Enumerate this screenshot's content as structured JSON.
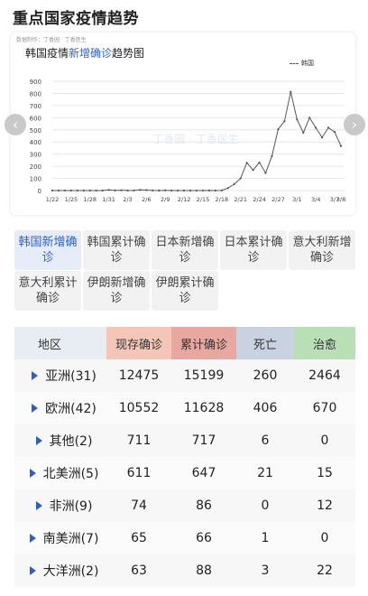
{
  "page": {
    "heading": "重点国家疫情趋势"
  },
  "chart_card": {
    "source": "数据制作：丁香园 · 丁香医生",
    "title_prefix": "韩国疫情",
    "title_highlight": "新增确诊",
    "title_suffix": "趋势图",
    "watermark": "丁香园 · 丁香医生",
    "prev_icon": "chevron-left-icon",
    "next_icon": "chevron-right-icon"
  },
  "chart_data": {
    "type": "line",
    "title": "韩国疫情新增确诊趋势图",
    "series": [
      {
        "name": "韩国",
        "color": "#555555",
        "x": [
          "1/22",
          "1/23",
          "1/24",
          "1/25",
          "1/26",
          "1/27",
          "1/28",
          "1/29",
          "1/30",
          "1/31",
          "2/1",
          "2/2",
          "2/3",
          "2/4",
          "2/5",
          "2/6",
          "2/7",
          "2/8",
          "2/9",
          "2/10",
          "2/11",
          "2/12",
          "2/13",
          "2/14",
          "2/15",
          "2/16",
          "2/17",
          "2/18",
          "2/19",
          "2/20",
          "2/21",
          "2/22",
          "2/23",
          "2/24",
          "2/25",
          "2/26",
          "2/27",
          "2/28",
          "2/29",
          "3/1",
          "3/2",
          "3/3",
          "3/4",
          "3/5",
          "3/6",
          "3/7",
          "3/8"
        ],
        "values": [
          0,
          0,
          0,
          0,
          0,
          0,
          0,
          0,
          0,
          5,
          1,
          3,
          0,
          1,
          5,
          4,
          1,
          0,
          2,
          0,
          0,
          0,
          0,
          0,
          0,
          1,
          0,
          1,
          20,
          53,
          100,
          229,
          169,
          231,
          144,
          284,
          505,
          571,
          813,
          586,
          476,
          600,
          516,
          438,
          518,
          483,
          367
        ]
      }
    ],
    "x_ticks": [
      "1/22",
      "1/25",
      "1/28",
      "1/31",
      "2/3",
      "2/6",
      "2/9",
      "2/12",
      "2/15",
      "2/18",
      "2/21",
      "2/24",
      "2/27",
      "3/1",
      "3/4",
      "3/7",
      "3/8"
    ],
    "y_ticks": [
      0,
      100,
      200,
      300,
      400,
      500,
      600,
      700,
      800,
      900
    ],
    "ylim": [
      0,
      900
    ],
    "grid": true,
    "legend": "top-right"
  },
  "tabs": [
    {
      "label": "韩国新增确诊",
      "active": true
    },
    {
      "label": "韩国累计确诊",
      "active": false
    },
    {
      "label": "日本新增确诊",
      "active": false
    },
    {
      "label": "日本累计确诊",
      "active": false
    },
    {
      "label": "意大利新增确诊",
      "active": false
    },
    {
      "label": "意大利累计确诊",
      "active": false
    },
    {
      "label": "伊朗新增确诊",
      "active": false
    },
    {
      "label": "伊朗累计确诊",
      "active": false
    }
  ],
  "table": {
    "headers": {
      "region": "地区",
      "current": "现存确诊",
      "total": "累计确诊",
      "deaths": "死亡",
      "cured": "治愈"
    },
    "header_colors": {
      "region": "#e8ecf3",
      "current": "#f3c6b7",
      "total": "#e8a8a0",
      "deaths": "#c9d2e0",
      "cured": "#b9dfb7"
    },
    "rows": [
      {
        "region": "亚洲(31)",
        "current": "12475",
        "total": "15199",
        "deaths": "260",
        "cured": "2464"
      },
      {
        "region": "欧洲(42)",
        "current": "10552",
        "total": "11628",
        "deaths": "406",
        "cured": "670"
      },
      {
        "region": "其他(2)",
        "current": "711",
        "total": "717",
        "deaths": "6",
        "cured": "0"
      },
      {
        "region": "北美洲(5)",
        "current": "611",
        "total": "647",
        "deaths": "21",
        "cured": "15"
      },
      {
        "region": "非洲(9)",
        "current": "74",
        "total": "86",
        "deaths": "0",
        "cured": "12"
      },
      {
        "region": "南美洲(7)",
        "current": "65",
        "total": "66",
        "deaths": "1",
        "cured": "0"
      },
      {
        "region": "大洋洲(2)",
        "current": "63",
        "total": "88",
        "deaths": "3",
        "cured": "22"
      }
    ]
  }
}
